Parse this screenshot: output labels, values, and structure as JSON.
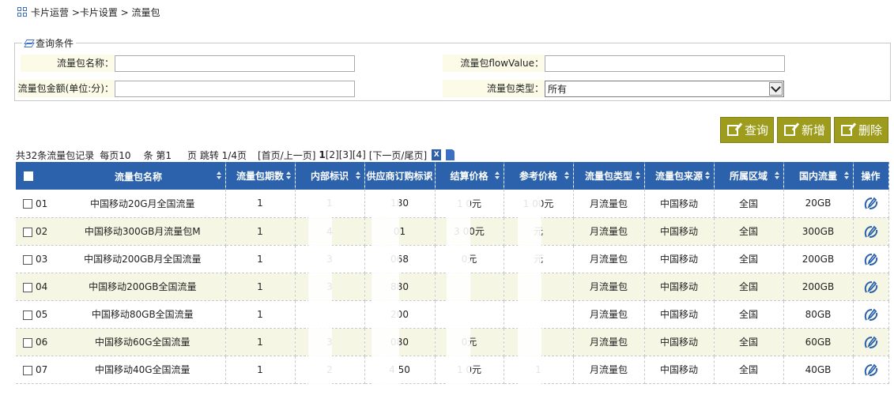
{
  "breadcrumb": "卡片运营 >卡片设置 > 流量包",
  "query": {
    "legend": "查询条件",
    "name_label": "流量包名称：",
    "flow_label": "流量包flowValue：",
    "amount_label": "流量包金额(单位:分)：",
    "type_label": "流量包类型：",
    "type_value": "所有"
  },
  "buttons": {
    "search": "查询",
    "add": "新增",
    "delete": "删除"
  },
  "pager": {
    "summary": "共32条流量包记录",
    "per_page_label": "每页10",
    "per_page_unit": "条 第1",
    "page_jump": "页 跳转 1/4页",
    "first_prev": "[首页/上一页]",
    "page1": "1",
    "pages_rest": "[2][3][4]",
    "next_last": "[下一页/尾页]"
  },
  "columns": [
    "流量包名称",
    "流量包期数",
    "内部标识",
    "供应商订购标识",
    "结算价格",
    "参考价格",
    "流量包类型",
    "流量包来源",
    "所属区域",
    "国内流量",
    "操作"
  ],
  "rows": [
    {
      "no": "01",
      "name": "中国移动20G月全国流量",
      "period": "1",
      "internal": "1",
      "supplier": "180",
      "settle": "1 0元",
      "ref": "1 00元",
      "type": "月流量包",
      "source": "中国移动",
      "region": "全国",
      "flow": "20GB"
    },
    {
      "no": "02",
      "name": "中国移动300GB月流量包M",
      "period": "1",
      "internal": "4",
      "supplier": "01",
      "settle": "3 00元",
      "ref": "元",
      "type": "月流量包",
      "source": "中国移动",
      "region": "全国",
      "flow": "300GB"
    },
    {
      "no": "03",
      "name": "中国移动200GB月全国流量",
      "period": "1",
      "internal": "3",
      "supplier": "068",
      "settle": "0元",
      "ref": "元",
      "type": "月流量包",
      "source": "中国移动",
      "region": "全国",
      "flow": "200GB"
    },
    {
      "no": "04",
      "name": "中国移动200GB全国流量",
      "period": "1",
      "internal": "3",
      "supplier": "880",
      "settle": "",
      "ref": "",
      "type": "月流量包",
      "source": "中国移动",
      "region": "全国",
      "flow": "200GB"
    },
    {
      "no": "05",
      "name": "中国移动80GB全国流量",
      "period": "1",
      "internal": "",
      "supplier": "200",
      "settle": "",
      "ref": "",
      "type": "月流量包",
      "source": "中国移动",
      "region": "全国",
      "flow": "80GB"
    },
    {
      "no": "06",
      "name": "中国移动60G全国流量",
      "period": "1",
      "internal": "3",
      "supplier": "080",
      "settle": "0元",
      "ref": "",
      "type": "月流量包",
      "source": "中国移动",
      "region": "全国",
      "flow": "60GB"
    },
    {
      "no": "07",
      "name": "中国移动40G全国流量",
      "period": "1",
      "internal": "2",
      "supplier": "4 50",
      "settle": "1 0元",
      "ref": "1",
      "type": "月流量包",
      "source": "中国移动",
      "region": "全国",
      "flow": "40GB"
    }
  ],
  "colors": {
    "header_bg": "#2b62ab",
    "button_bg": "#9e9c1c",
    "row_alt": "#f6f6e4"
  }
}
